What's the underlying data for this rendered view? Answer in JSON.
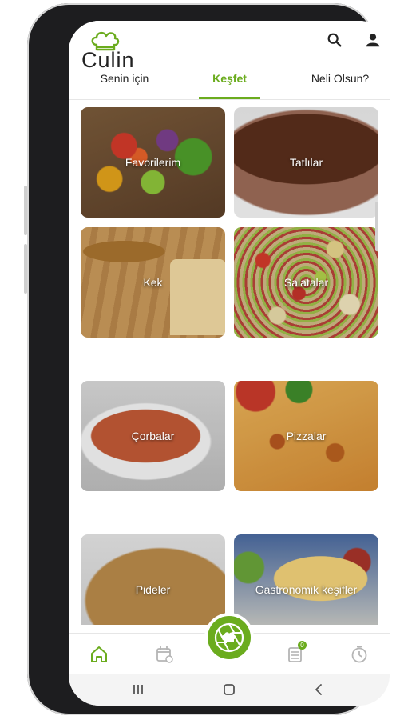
{
  "app": {
    "logo_text": "Culin"
  },
  "header": {
    "search_icon": "search-icon",
    "profile_icon": "profile-icon"
  },
  "tabs": [
    {
      "label": "Senin için"
    },
    {
      "label": "Keşfet"
    },
    {
      "label": "Neli Olsun?"
    }
  ],
  "categories": [
    {
      "label": "Favorilerim"
    },
    {
      "label": "Tatlılar"
    },
    {
      "label": "Kek"
    },
    {
      "label": "Salatalar"
    },
    {
      "label": "Çorbalar"
    },
    {
      "label": "Pizzalar"
    },
    {
      "label": "Pideler"
    },
    {
      "label": "Gastronomik keşifler"
    }
  ],
  "bottom_nav": [
    {
      "icon": "home-icon"
    },
    {
      "icon": "calendar-icon"
    },
    {
      "icon": "camera-chef-icon"
    },
    {
      "icon": "list-icon",
      "badge": "0"
    },
    {
      "icon": "timer-icon"
    }
  ],
  "colors": {
    "accent": "#6bac1e"
  }
}
